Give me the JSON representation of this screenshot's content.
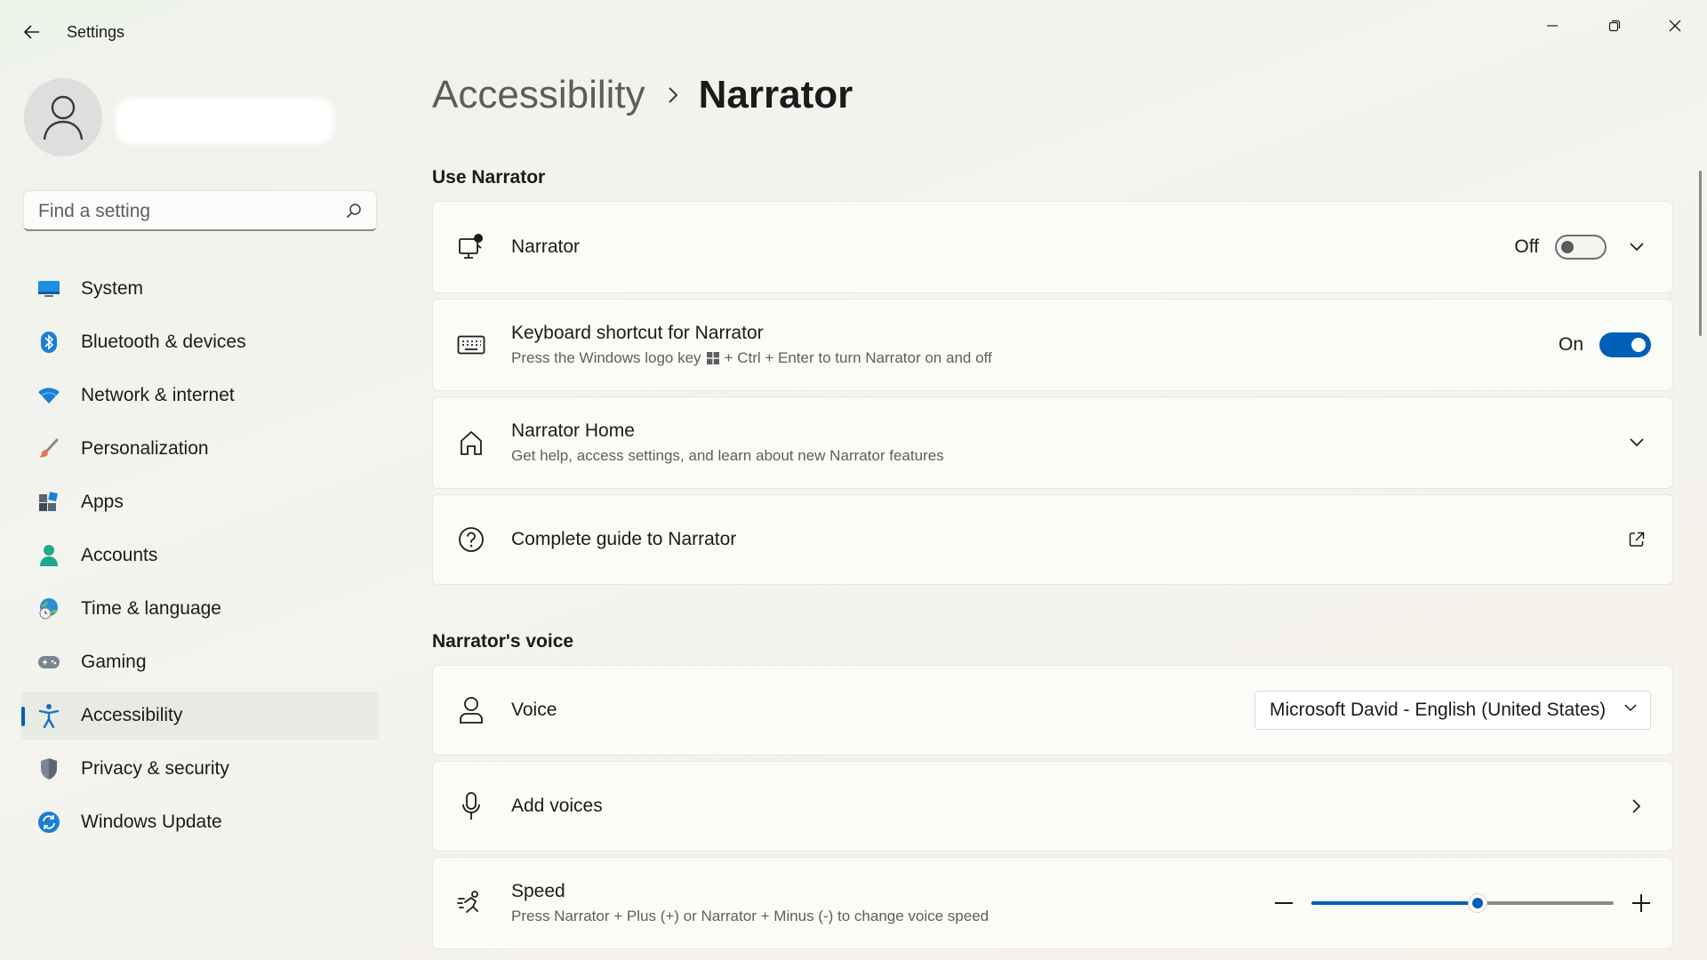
{
  "window": {
    "title": "Settings",
    "controls": [
      "minimize-icon",
      "restore-icon",
      "close-icon"
    ]
  },
  "user": {
    "avatar_icon": "person-icon"
  },
  "search": {
    "placeholder": "Find a setting",
    "icon": "search-icon"
  },
  "sidebar": {
    "items": [
      {
        "label": "System",
        "icon": "system-icon"
      },
      {
        "label": "Bluetooth & devices",
        "icon": "bluetooth-icon"
      },
      {
        "label": "Network & internet",
        "icon": "wifi-icon"
      },
      {
        "label": "Personalization",
        "icon": "brush-icon"
      },
      {
        "label": "Apps",
        "icon": "apps-icon"
      },
      {
        "label": "Accounts",
        "icon": "accounts-icon"
      },
      {
        "label": "Time & language",
        "icon": "globe-clock-icon"
      },
      {
        "label": "Gaming",
        "icon": "gamepad-icon"
      },
      {
        "label": "Accessibility",
        "icon": "accessibility-icon",
        "active": true
      },
      {
        "label": "Privacy & security",
        "icon": "shield-icon"
      },
      {
        "label": "Windows Update",
        "icon": "update-icon"
      }
    ]
  },
  "breadcrumb": {
    "parent": "Accessibility",
    "current": "Narrator"
  },
  "sections": {
    "use_narrator": {
      "title": "Use Narrator",
      "narrator": {
        "title": "Narrator",
        "state_label": "Off",
        "enabled": false,
        "icon": "narrator-icon"
      },
      "shortcut": {
        "title": "Keyboard shortcut for Narrator",
        "sub_before": "Press the Windows logo key",
        "sub_after": "+ Ctrl + Enter to turn Narrator on and off",
        "state_label": "On",
        "enabled": true,
        "icon": "keyboard-icon"
      },
      "home": {
        "title": "Narrator Home",
        "sub": "Get help, access settings, and learn about new Narrator features",
        "icon": "home-icon"
      },
      "guide": {
        "title": "Complete guide to Narrator",
        "icon": "help-icon"
      }
    },
    "voice": {
      "title": "Narrator's voice",
      "voice": {
        "title": "Voice",
        "selected": "Microsoft David - English (United States)",
        "icon": "person-voice-icon"
      },
      "add_voices": {
        "title": "Add voices",
        "icon": "microphone-icon"
      },
      "speed": {
        "title": "Speed",
        "sub": "Press Narrator + Plus (+) or Narrator + Minus (-) to change voice speed",
        "value_fraction": 0.55,
        "icon": "speed-icon"
      }
    }
  },
  "colors": {
    "accent": "#005fb8"
  }
}
